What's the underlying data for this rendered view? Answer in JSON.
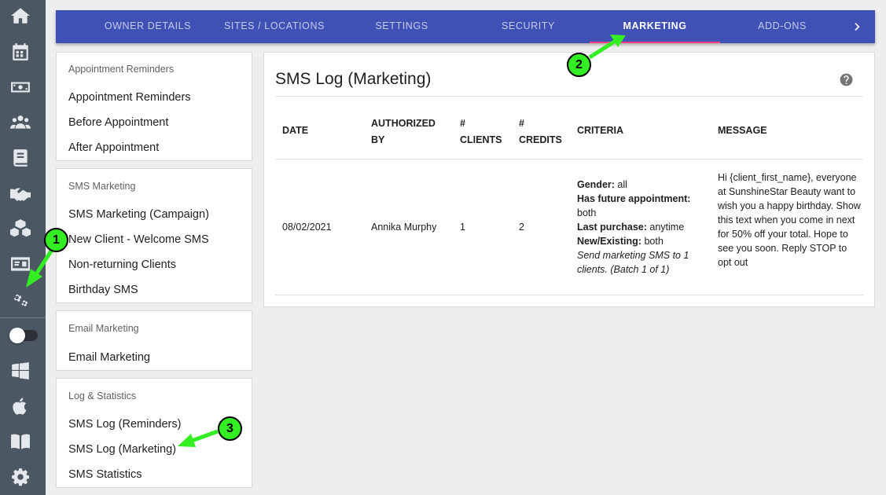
{
  "sidebar_icons": [
    {
      "name": "home-icon"
    },
    {
      "name": "calendar-icon"
    },
    {
      "name": "money-icon"
    },
    {
      "name": "clients-icon"
    },
    {
      "name": "book-icon"
    },
    {
      "name": "handshake-icon"
    },
    {
      "name": "boxes-icon"
    },
    {
      "name": "id-card-icon"
    },
    {
      "name": "cogs-icon"
    },
    {
      "name": "windows-icon"
    },
    {
      "name": "apple-icon"
    },
    {
      "name": "guide-book-icon"
    },
    {
      "name": "gear-icon"
    }
  ],
  "toggle": {
    "on": false
  },
  "tabs": [
    {
      "label": "OWNER DETAILS"
    },
    {
      "label": "SITES / LOCATIONS"
    },
    {
      "label": "SETTINGS"
    },
    {
      "label": "SECURITY"
    },
    {
      "label": "MARKETING"
    },
    {
      "label": "ADD-ONS"
    }
  ],
  "active_tab": "MARKETING",
  "menu": {
    "reminders": {
      "heading": "Appointment Reminders",
      "items": [
        "Appointment Reminders",
        "Before Appointment",
        "After Appointment"
      ]
    },
    "sms_marketing": {
      "heading": "SMS Marketing",
      "items": [
        "SMS Marketing (Campaign)",
        "New Client - Welcome SMS",
        "Non-returning Clients",
        "Birthday SMS"
      ]
    },
    "email_marketing": {
      "heading": "Email Marketing",
      "items": [
        "Email Marketing"
      ]
    },
    "log_stats": {
      "heading": "Log & Statistics",
      "items": [
        "SMS Log (Reminders)",
        "SMS Log (Marketing)",
        "SMS Statistics"
      ]
    }
  },
  "panel": {
    "title": "SMS Log (Marketing)",
    "columns": {
      "date": "DATE",
      "authorized_1": "AUTHORIZED",
      "authorized_2": "BY",
      "clients_1": "#",
      "clients_2": "CLIENTS",
      "credits_1": "#",
      "credits_2": "CREDITS",
      "criteria": "CRITERIA",
      "message": "MESSAGE"
    },
    "row": {
      "date": "08/02/2021",
      "authorized_by": "Annika Murphy",
      "clients": "1",
      "credits": "2",
      "criteria": {
        "gender_label": "Gender:",
        "gender_value": "all",
        "future_label": "Has future appointment:",
        "future_value": "both",
        "purchase_label": "Last purchase:",
        "purchase_value": "anytime",
        "newexisting_label": "New/Existing:",
        "newexisting_value": "both",
        "note": "Send marketing SMS to 1 clients. (Batch 1 of 1)"
      },
      "message": "Hi {client_first_name}, everyone at SunshineStar Beauty want to wish you a happy birthday. Show this text when you come in next for 50% off your total. Hope to see you soon. Reply STOP to opt out"
    }
  },
  "callouts": [
    "1",
    "2",
    "3"
  ],
  "colors": {
    "rail": "#4b5762",
    "tabbar": "#3f51b5",
    "tab_indicator": "#ff4081",
    "callout": "#33ee22"
  }
}
